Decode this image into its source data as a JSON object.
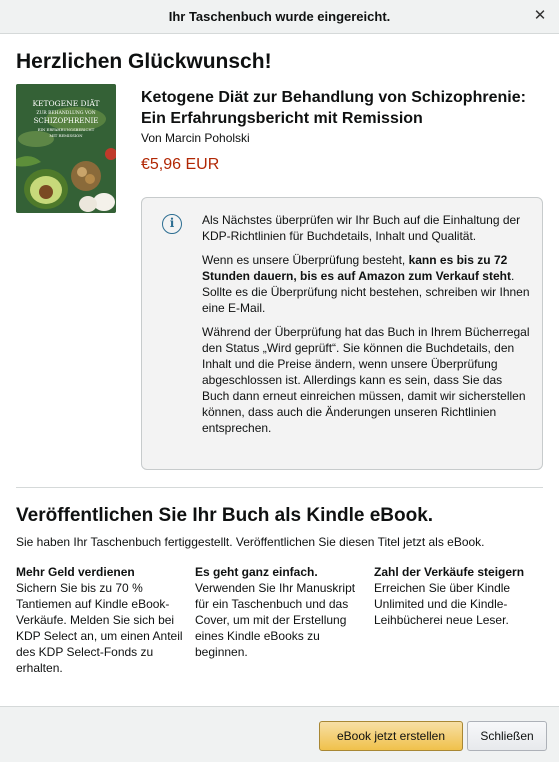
{
  "dialog": {
    "header_title": "Ihr Taschenbuch wurde eingereicht.",
    "close_icon": "close-icon"
  },
  "congrats": "Herzlichen Glückwunsch!",
  "book": {
    "title": "Ketogene Diät zur Behandlung von Schizophrenie: Ein Erfahrungsbericht mit Remission",
    "author": "Von Marcin Poholski",
    "price": "€5,96 EUR",
    "cover": {
      "line1": "KETOGENE DIÄT",
      "line2": "ZUR BEHANDLUNG VON",
      "line3": "SCHIZOPHRENIE",
      "line4": "EIN ERFAHRUNGSBERICHT",
      "line5": "MIT REMISSION"
    }
  },
  "info": {
    "icon": "info-icon",
    "p1": "Als Nächstes überprüfen wir Ihr Buch auf die Einhaltung der KDP-Richtlinien für Buchdetails, Inhalt und Qualität.",
    "p2_pre": "Wenn es unsere Überprüfung besteht, ",
    "p2_bold": "kann es bis zu 72 Stunden dauern, bis es auf Amazon zum Verkauf steht",
    "p2_post": ". Sollte es die Überprüfung nicht bestehen, schreiben wir Ihnen eine E-Mail.",
    "p3": "Während der Überprüfung hat das Buch in Ihrem Bücherregal den Status „Wird geprüft“. Sie können die Buchdetails, den Inhalt und die Preise ändern, wenn unsere Überprüfung abgeschlossen ist. Allerdings kann es sein, dass Sie das Buch dann erneut einreichen müssen, damit wir sicherstellen können, dass auch die Änderungen unseren Richtlinien entsprechen."
  },
  "publish": {
    "title": "Veröffentlichen Sie Ihr Buch als Kindle eBook.",
    "subtitle": "Sie haben Ihr Taschenbuch fertiggestellt. Veröffentlichen Sie diesen Titel jetzt als eBook.",
    "columns": [
      {
        "title": "Mehr Geld verdienen",
        "text": "Sichern Sie bis zu 70 % Tantiemen auf Kindle eBook-Verkäufe. Melden Sie sich bei KDP Select an, um einen Anteil des KDP Select-Fonds zu erhalten."
      },
      {
        "title": "Es geht ganz einfach.",
        "text": "Verwenden Sie Ihr Manuskript für ein Taschenbuch und das Cover, um mit der Erstellung eines Kindle eBooks zu beginnen."
      },
      {
        "title": "Zahl der Verkäufe steigern",
        "text": "Erreichen Sie über Kindle Unlimited und die Kindle-Leihbücherei neue Leser."
      }
    ]
  },
  "footer": {
    "create_ebook_label": "eBook jetzt erstellen",
    "close_label": "Schließen"
  },
  "colors": {
    "price": "#b12704",
    "primary_button": "#f0c14b",
    "header_bg": "#f0f2f2"
  }
}
